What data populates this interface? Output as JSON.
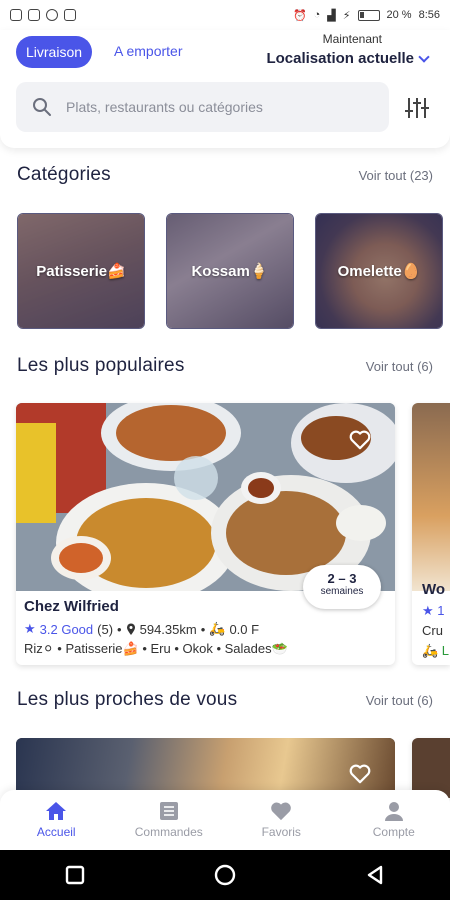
{
  "status_bar": {
    "battery": "20 %",
    "time": "8:56"
  },
  "header": {
    "mode_active": "Livraison",
    "mode_other": "A emporter",
    "location_label": "Maintenant",
    "location_value": "Localisation actuelle"
  },
  "search": {
    "placeholder": "Plats, restaurants ou catégories"
  },
  "categories": {
    "title": "Catégories",
    "see_all": "Voir tout (23)",
    "items": [
      {
        "label": "Patisserie🍰"
      },
      {
        "label": "Kossam🍦"
      },
      {
        "label": "Omelette🥚"
      }
    ]
  },
  "popular": {
    "title": "Les plus populaires",
    "see_all": "Voir tout (6)",
    "card": {
      "name": "Chez Wilfried",
      "rating": "3.2 Good",
      "reviews": "(5)",
      "distance": "594.35km",
      "delivery_fee": "0.0 F",
      "tags": "Riz⚪ • Patisserie🍰 • Eru • Okok • Salades🥗",
      "delay_top": "2 – 3",
      "delay_bottom": "semaines"
    },
    "peek": {
      "name": "Wo",
      "rating": "★ 1",
      "tags": "Cru",
      "fee": "🛵 L"
    }
  },
  "nearby": {
    "title": "Les plus proches de vous",
    "see_all": "Voir tout (6)"
  },
  "nav": {
    "items": [
      {
        "label": "Accueil"
      },
      {
        "label": "Commandes"
      },
      {
        "label": "Favoris"
      },
      {
        "label": "Compte"
      }
    ]
  },
  "colors": {
    "accent": "#4a55e8",
    "text": "#1f2340"
  }
}
